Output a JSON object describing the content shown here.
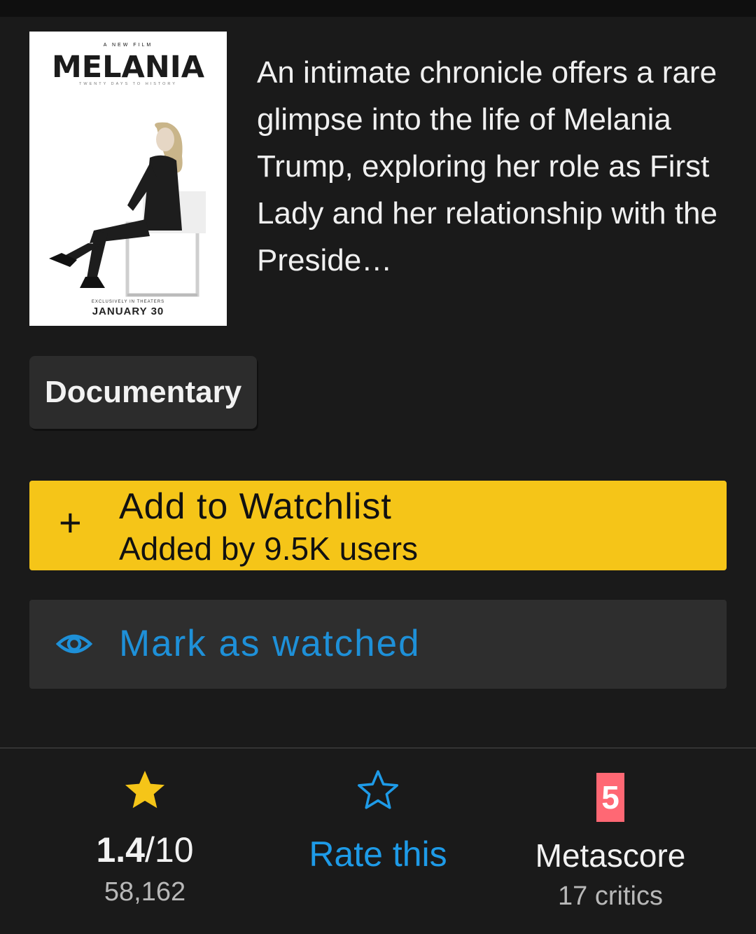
{
  "poster": {
    "kicker": "A NEW FILM",
    "title": "MELANIA",
    "tagline": "TWENTY DAYS TO HISTORY",
    "release_note": "EXCLUSIVELY IN THEATERS",
    "release_date": "JANUARY 30"
  },
  "description": "An intimate chronicle offers a rare glimpse into the life of Melania Trump, exploring her role as First Lady and her relationship with the Preside…",
  "genres": [
    "Documentary"
  ],
  "watchlist": {
    "icon": "plus-icon",
    "label": "Add to Watchlist",
    "sublabel": "Added by 9.5K users"
  },
  "watched": {
    "icon": "eye-icon",
    "label": "Mark as watched"
  },
  "stats": {
    "rating": {
      "icon": "star-filled-icon",
      "value": "1.4",
      "scale": "/10",
      "count": "58,162"
    },
    "rate": {
      "icon": "star-outline-icon",
      "label": "Rate this"
    },
    "metascore": {
      "value": "5",
      "label": "Metascore",
      "count": "17 critics"
    }
  },
  "colors": {
    "accent_yellow": "#f5c518",
    "link_blue": "#1e9be8",
    "metascore_red": "#ff6874",
    "background": "#1a1a1a"
  }
}
